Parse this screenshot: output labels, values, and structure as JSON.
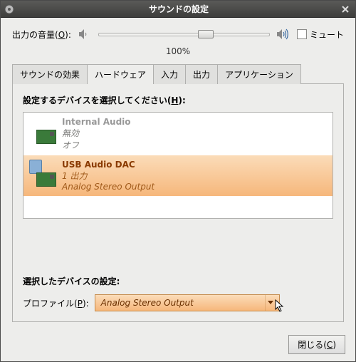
{
  "window": {
    "title": "サウンドの設定"
  },
  "volume": {
    "label_pre": "出力の音量(",
    "label_key": "O",
    "label_post": "):",
    "percent": "100%",
    "mute_label": "ミュート"
  },
  "tabs": [
    {
      "label": "サウンドの効果"
    },
    {
      "label": "ハードウェア"
    },
    {
      "label": "入力"
    },
    {
      "label": "出力"
    },
    {
      "label": "アプリケーション"
    }
  ],
  "hw": {
    "list_label_pre": "設定するデバイスを選択してください(",
    "list_label_key": "H",
    "list_label_post": "):",
    "devices": [
      {
        "title": "Internal Audio",
        "sub1": "無効",
        "sub2": "オフ"
      },
      {
        "title": "USB Audio DAC",
        "sub1": "1 出力",
        "sub2": "Analog Stereo Output"
      }
    ],
    "selected_label": "選択したデバイスの設定:",
    "profile_label_pre": "プロファイル(",
    "profile_label_key": "P",
    "profile_label_post": "):",
    "profile_value": "Analog Stereo Output"
  },
  "buttons": {
    "close_pre": "閉じる(",
    "close_key": "C",
    "close_post": ")"
  }
}
